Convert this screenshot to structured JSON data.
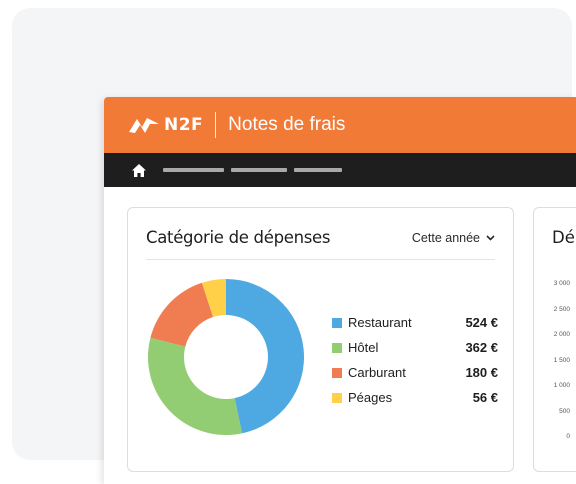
{
  "app": {
    "brand": "N2F",
    "title": "Notes de frais"
  },
  "colors": {
    "header": "#f27a37",
    "nav": "#1e1e1e",
    "restaurant": "#4ea8e1",
    "hotel": "#92cd73",
    "carburant": "#f07d52",
    "peages": "#ffd048"
  },
  "nav": {
    "home_icon": "home-icon"
  },
  "expenses_panel": {
    "title": "Catégorie de dépenses",
    "period": "Cette année"
  },
  "side_panel": {
    "title": "Dé",
    "y_ticks": [
      "3 000",
      "2 500",
      "2 000",
      "1 500",
      "1 000",
      "500",
      "0"
    ]
  },
  "chart_data": {
    "type": "pie",
    "title": "Catégorie de dépenses",
    "unit": "€",
    "categories": [
      "Restaurant",
      "Hôtel",
      "Carburant",
      "Péages"
    ],
    "values": [
      524,
      362,
      180,
      56
    ],
    "value_labels": [
      "524 €",
      "362 €",
      "180 €",
      "56 €"
    ],
    "colors": [
      "#4ea8e1",
      "#92cd73",
      "#f07d52",
      "#ffd048"
    ],
    "legend": "right"
  }
}
